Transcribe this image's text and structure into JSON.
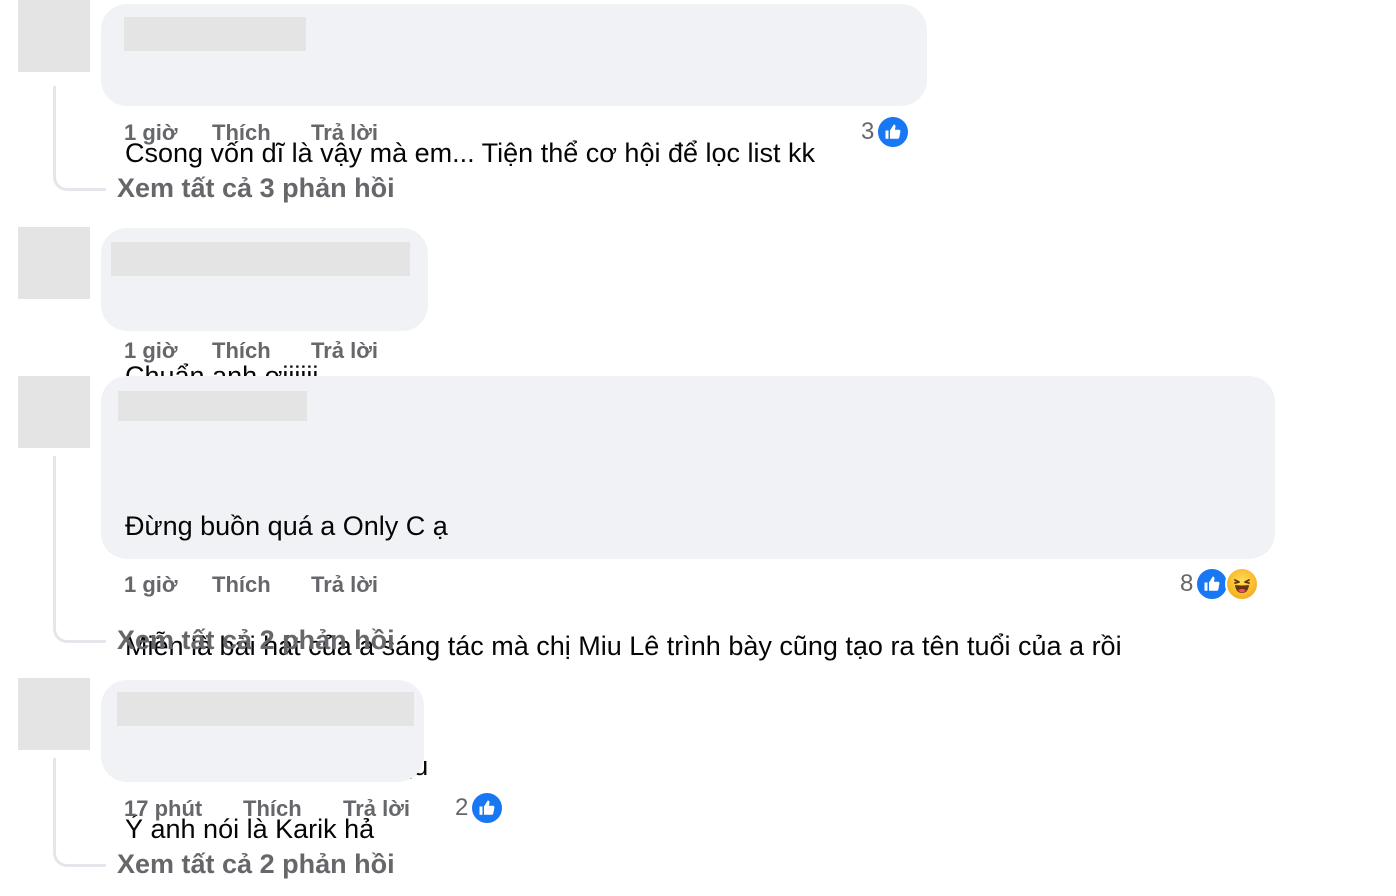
{
  "comments": [
    {
      "lines": [
        "Csong vốn dĩ là vậy mà em... Tiện thể cơ hội để lọc list kk"
      ],
      "time": "1 giờ",
      "like_label": "Thích",
      "reply_label": "Trả lời",
      "reaction_count": "3",
      "reactions": [
        "like-icon"
      ],
      "view_replies": "Xem tất cả 3 phản hồi"
    },
    {
      "lines": [
        "Chuẩn anh ơiiiiii"
      ],
      "time": "1 giờ",
      "like_label": "Thích",
      "reply_label": "Trả lời"
    },
    {
      "lines": [
        "Đừng buồn quá a Only C ạ",
        "Miễn là bài hát của a sáng tác mà chị Miu Lê trình bày cũng tạo ra tên tuổi của a rồi",
        "Chị Miu tự làm thì tự chịu"
      ],
      "time": "1 giờ",
      "like_label": "Thích",
      "reply_label": "Trả lời",
      "reaction_count": "8",
      "reactions": [
        "like-icon",
        "haha-icon"
      ],
      "view_replies": "Xem tất cả 2 phản hồi"
    },
    {
      "lines": [
        "Ý anh nói là Karik hả"
      ],
      "time": "17 phút",
      "like_label": "Thích",
      "reply_label": "Trả lời",
      "reaction_count": "2",
      "reactions": [
        "like-icon"
      ],
      "view_replies": "Xem tất cả 2 phản hồi"
    }
  ],
  "colors": {
    "bubble_bg": "#f0f2f5",
    "meta_text": "#65676b",
    "like_blue": "#1877f2",
    "placeholder_gray": "#e4e4e4"
  }
}
